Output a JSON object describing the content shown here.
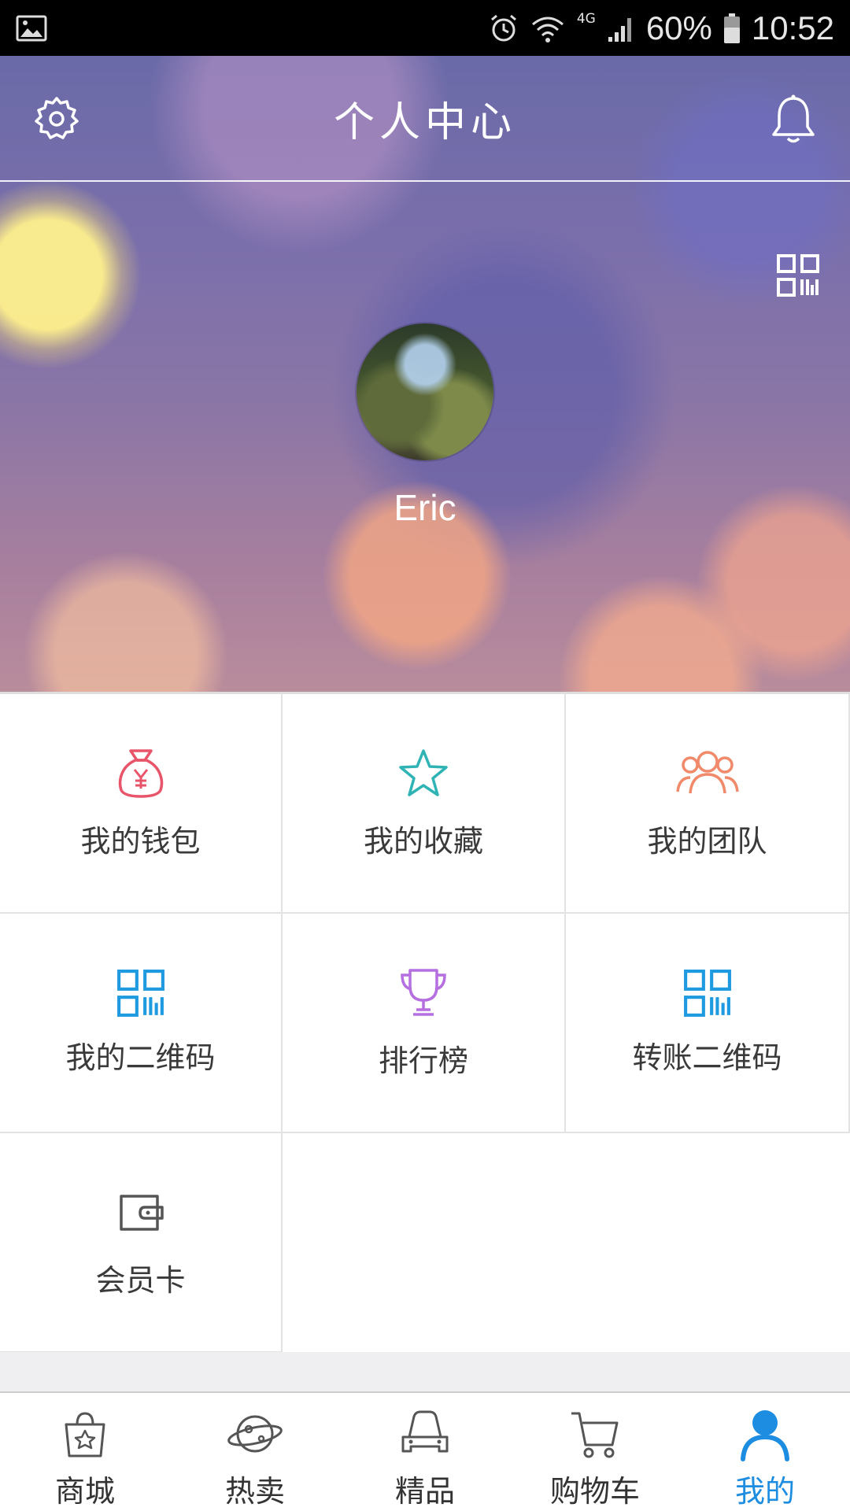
{
  "status_bar": {
    "network": "4G",
    "battery": "60%",
    "time": "10:52"
  },
  "header": {
    "title": "个人中心"
  },
  "profile": {
    "username": "Eric"
  },
  "menu": {
    "items": [
      {
        "label": "我的钱包",
        "icon": "money-bag-icon",
        "color": "#e8556a"
      },
      {
        "label": "我的收藏",
        "icon": "star-icon",
        "color": "#2fb3b5"
      },
      {
        "label": "我的团队",
        "icon": "team-icon",
        "color": "#f08a6a"
      },
      {
        "label": "我的二维码",
        "icon": "qr-code-icon",
        "color": "#1e9be0"
      },
      {
        "label": "排行榜",
        "icon": "trophy-icon",
        "color": "#b56fe0"
      },
      {
        "label": "转账二维码",
        "icon": "qr-code-icon",
        "color": "#1e9be0"
      },
      {
        "label": "会员卡",
        "icon": "wallet-card-icon",
        "color": "#555555"
      }
    ]
  },
  "tabbar": {
    "tabs": [
      {
        "label": "商城",
        "icon": "shopping-bag-icon"
      },
      {
        "label": "热卖",
        "icon": "planet-icon"
      },
      {
        "label": "精品",
        "icon": "car-icon"
      },
      {
        "label": "购物车",
        "icon": "cart-icon"
      },
      {
        "label": "我的",
        "icon": "user-icon",
        "active": true
      }
    ],
    "active_color": "#1c8de0"
  }
}
